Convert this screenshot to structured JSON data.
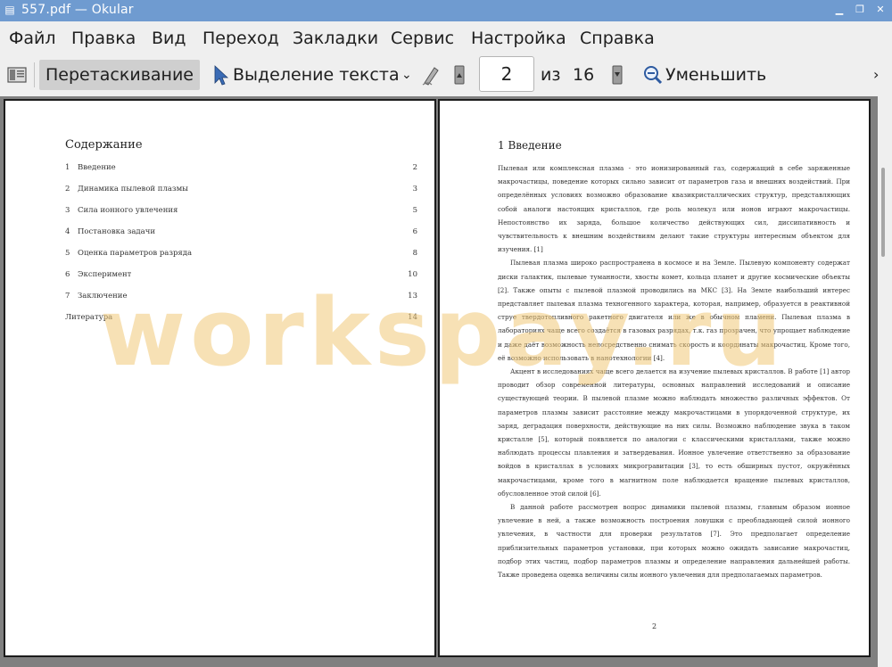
{
  "window": {
    "title": "557.pdf  — Okular"
  },
  "menu": [
    "Файл",
    "Правка",
    "Вид",
    "Переход",
    "Закладки",
    "Сервис",
    "Настройка",
    "Справка"
  ],
  "toolbar": {
    "drag_label": "Перетаскивание",
    "select_label": "Выделение текста",
    "page_current": "2",
    "of_label": "из",
    "page_total": "16",
    "zoom_out_label": "Уменьшить"
  },
  "toc": {
    "title": "Содержание",
    "items": [
      {
        "num": "1",
        "text": "Введение",
        "page": "2"
      },
      {
        "num": "2",
        "text": "Динамика пылевой плазмы",
        "page": "3"
      },
      {
        "num": "3",
        "text": "Сила ионного увлечения",
        "page": "5"
      },
      {
        "num": "4",
        "text": "Постановка задачи",
        "page": "6"
      },
      {
        "num": "5",
        "text": "Оценка параметров разряда",
        "page": "8"
      },
      {
        "num": "6",
        "text": "Эксперимент",
        "page": "10"
      },
      {
        "num": "7",
        "text": "Заключение",
        "page": "13"
      },
      {
        "num": "",
        "text": "Литература",
        "page": "14"
      }
    ]
  },
  "section": {
    "title": "1    Введение",
    "paragraphs": [
      "Пылевая или комплексная плазма - это ионизированный газ, содержащий в себе заряженные макрочастицы, поведение которых сильно зависит от параметров газа и внешних воздействий. При определённых условиях возможно образование квазикристаллических структур, представляющих собой аналоги настоящих кристаллов, где роль молекул или ионов играют макрочастицы. Непостоянство их заряда, большое количество действующих сил, диссипативность и чувствительность к внешним воздействиям делают такие структуры интересным объектом для изучения. [1]",
      "Пылевая плазма широко распространена в космосе и на Земле. Пылевую компоненту содержат диски галактик, пылевые туманности, хвосты комет, кольца планет и другие космические объекты [2]. Также опыты с пылевой плазмой проводились на МКС [3]. На Земле наибольший интерес представляет пылевая плазма техногенного характера, которая, например, образуется в реактивной струе твердотопливного ракетного двигателя или же в обычном пламени. Пылевая плазма в лабораториях чаще всего создаётся в газовых разрядах, т.к. газ прозрачен, что упрощает наблюдение и даже даёт возможность непосредственно снимать скорость и координаты макрочастиц. Кроме того, её возможно использовать в нанотехнологии [4].",
      "Акцент в исследованиях чаще всего делается на изучение пылевых кристаллов. В работе [1] автор проводит обзор современной литературы, основных направлений исследований и описание существующей теории. В пылевой плазме можно наблюдать множество различных эффектов. От параметров плазмы зависит расстояние между макрочастицами в упорядоченной структуре, их заряд, деградация поверхности, действующие на них силы. Возможно наблюдение звука в таком кристалле [5], который появляется по аналогии с классическими кристаллами, также можно наблюдать процессы плавления и затвердевания. Ионное увлечение ответственно за образование войдов в кристаллах в условиях микрогравитации [3], то есть обширных пустот, окружённых макрочастицами, кроме того в магнитном поле наблюдается вращение пылевых кристаллов, обусловленное этой силой [6].",
      "В данной работе рассмотрен вопрос динамики пылевой плазмы, главным образом ионное увлечение в ней, а также возможность построения ловушки с преобладающей силой ионного увлечения, в частности для проверки результатов [7]. Это предполагает определение приблизительных параметров установки, при которых можно ожидать зависание макрочастиц, подбор этих частиц, подбор параметров плазмы и определение направления дальнейшей работы. Также проведена оценка величины силы ионного увлечения для предполагаемых параметров."
    ],
    "page_number": "2"
  },
  "watermark": "workspay.ru",
  "colors": {
    "titlebar": "#6f9bd0",
    "chrome": "#efefef",
    "viewer_bg": "#808080"
  }
}
